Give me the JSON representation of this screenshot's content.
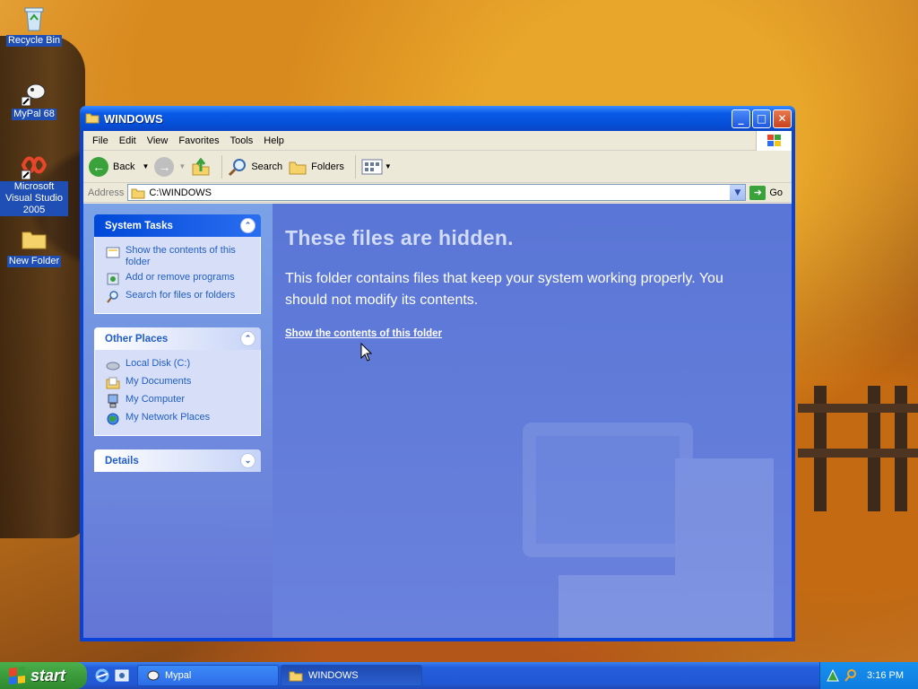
{
  "desktop": {
    "icons": [
      {
        "label": "Recycle Bin",
        "icon": "recycle-bin-icon"
      },
      {
        "label": "MyPal 68",
        "icon": "mypal-icon"
      },
      {
        "label": "Microsoft Visual Studio 2005",
        "icon": "visual-studio-icon"
      },
      {
        "label": "New Folder",
        "icon": "folder-icon"
      }
    ]
  },
  "window": {
    "title": "WINDOWS",
    "menu": [
      "File",
      "Edit",
      "View",
      "Favorites",
      "Tools",
      "Help"
    ],
    "toolbar": {
      "back": "Back",
      "search": "Search",
      "folders": "Folders"
    },
    "address": {
      "label": "Address",
      "value": "C:\\WINDOWS",
      "go": "Go"
    },
    "task_pane": {
      "system_tasks": {
        "title": "System Tasks",
        "items": [
          "Show the contents of this folder",
          "Add or remove programs",
          "Search for files or folders"
        ]
      },
      "other_places": {
        "title": "Other Places",
        "items": [
          "Local Disk (C:)",
          "My Documents",
          "My Computer",
          "My Network Places"
        ]
      },
      "details": {
        "title": "Details"
      }
    },
    "main": {
      "heading": "These files are hidden.",
      "message": "This folder contains files that keep your system working properly. You should not modify its contents.",
      "link": "Show the contents of this folder"
    }
  },
  "taskbar": {
    "start": "start",
    "items": [
      "Mypal",
      "WINDOWS"
    ],
    "clock": "3:16 PM"
  },
  "colors": {
    "accent": "#0842d6",
    "pane": "#6375d6",
    "taskbar": "#245edb",
    "start": "#3c9b3c"
  }
}
